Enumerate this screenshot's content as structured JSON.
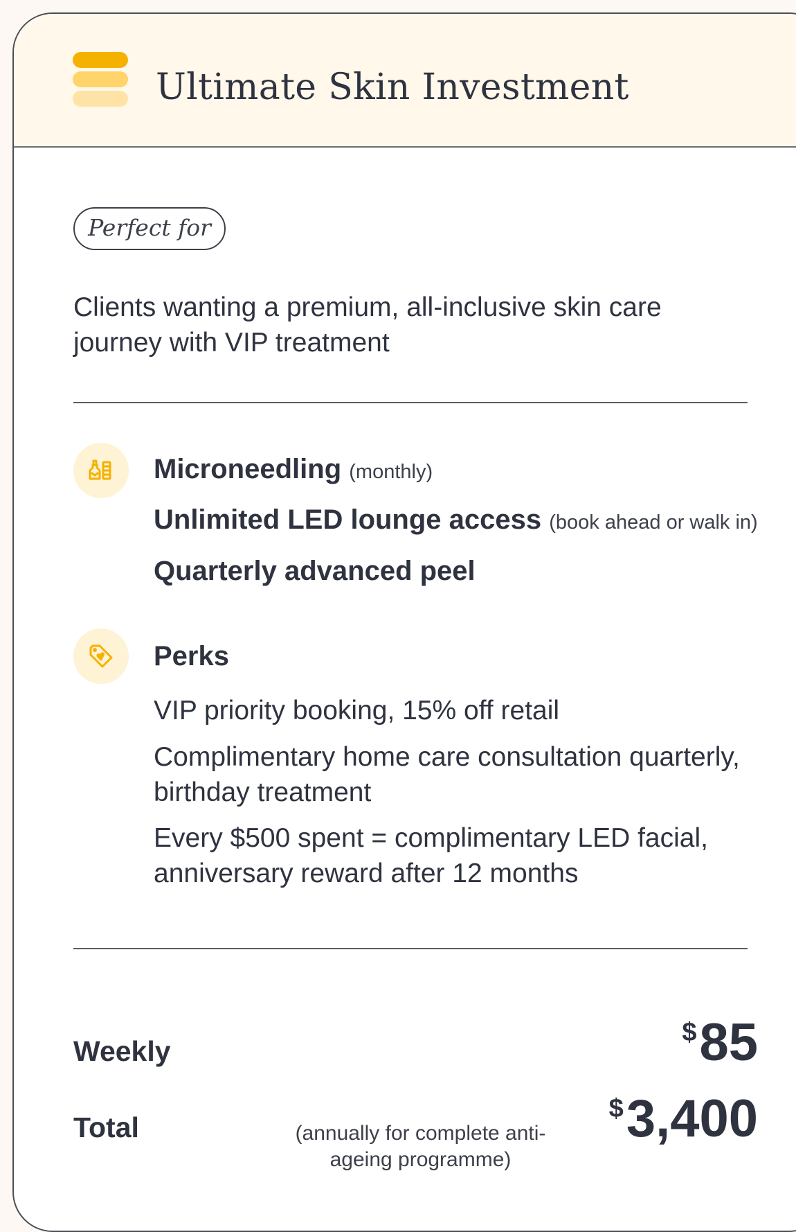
{
  "theme": {
    "accent_dark": "#f5b100",
    "accent_mid": "#ffd46b",
    "accent_light": "#ffe3a6",
    "icon_bg": "#fff3d6",
    "header_bg": "#fff8eb",
    "text": "#2f3340"
  },
  "card": {
    "title": "Ultimate Skin Investment",
    "logo_icon": "stacked-bars-icon"
  },
  "perfect_for": {
    "badge": "Perfect for",
    "description": "Clients wanting a premium, all-inclusive skin care journey with VIP treatment"
  },
  "treatments": {
    "icon": "skincare-bottles-icon",
    "items": [
      {
        "name": "Microneedling",
        "note": "(monthly)"
      },
      {
        "name": "Unlimited LED lounge access",
        "note": "(book ahead or walk in)"
      },
      {
        "name": "Quarterly advanced peel",
        "note": ""
      }
    ]
  },
  "perks": {
    "icon": "tag-heart-icon",
    "heading": "Perks",
    "items": [
      "VIP priority booking, 15% off retail",
      "Complimentary home care consultation quarterly, birthday treatment",
      "Every $500 spent = complimentary LED facial, anniversary reward after 12 months"
    ]
  },
  "pricing": {
    "weekly_label": "Weekly",
    "weekly_currency": "$",
    "weekly_amount": "85",
    "total_label": "Total",
    "total_note": "(annually for complete anti-ageing programme)",
    "total_currency": "$",
    "total_amount": "3,400"
  }
}
